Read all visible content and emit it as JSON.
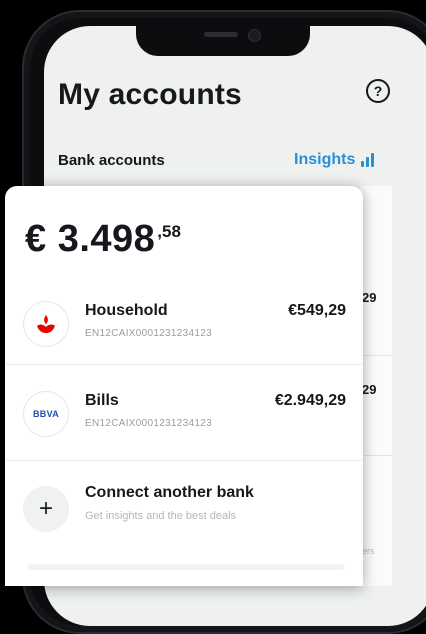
{
  "header": {
    "title": "My accounts",
    "help_icon_glyph": "?"
  },
  "section": {
    "label": "Bank accounts",
    "insights_label": "Insights"
  },
  "balance": {
    "main": "€ 3.498",
    "decimals": ",58"
  },
  "accounts": [
    {
      "name": "Household",
      "iban": "EN12CAIX0001231234123",
      "amount": "€549,29",
      "logo": "santander-flame-logo",
      "logo_color": "#ec0000"
    },
    {
      "name": "Bills",
      "iban": "EN12CAIX0001231234123",
      "amount": "€2.949,29",
      "logo_text": "BBVA",
      "logo_color": "#1d4ea8"
    }
  ],
  "connect": {
    "title": "Connect another bank",
    "subtitle": "Get insights and the best deals",
    "icon_glyph": "+"
  },
  "background_list": {
    "amount_fragment_1": "29",
    "amount_fragment_2": "29",
    "tiny_text": "ers"
  },
  "colors": {
    "accent": "#2a8fd4",
    "text": "#16181d",
    "muted": "#9a9d9a",
    "screen_bg": "#eef1ee"
  }
}
